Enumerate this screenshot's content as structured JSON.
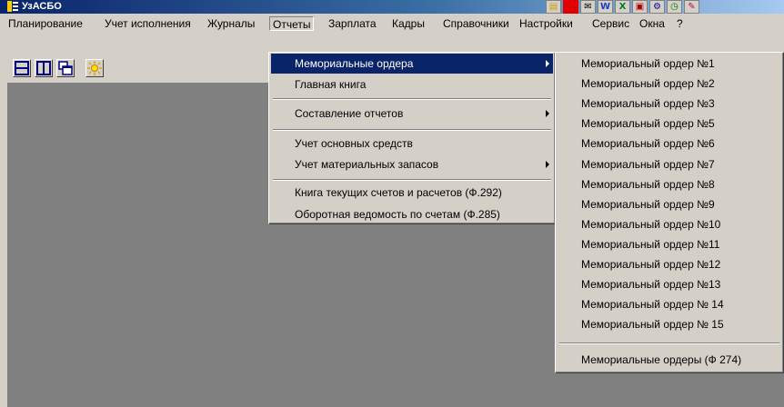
{
  "window": {
    "title": "УзАСБО"
  },
  "task_icons": [
    {
      "icon": "app-tile-icon",
      "glyph": "▤",
      "color": "#c8a000"
    },
    {
      "icon": "red-block-icon",
      "glyph": "",
      "color": "#e00000"
    },
    {
      "icon": "mail-icon",
      "glyph": "✉",
      "color": "#000000"
    },
    {
      "icon": "word-icon",
      "glyph": "W",
      "color": "#1a3dbf"
    },
    {
      "icon": "excel-icon",
      "glyph": "X",
      "color": "#007a33"
    },
    {
      "icon": "access-icon",
      "glyph": "▣",
      "color": "#b00000"
    },
    {
      "icon": "tools-icon",
      "glyph": "⚙",
      "color": "#0000a0"
    },
    {
      "icon": "clock-icon",
      "glyph": "◷",
      "color": "#008000"
    },
    {
      "icon": "notes-icon",
      "glyph": "✎",
      "color": "#c00060"
    }
  ],
  "menubar": {
    "items": [
      "Планирование",
      "Учет исполнения",
      "Журналы",
      "Отчеты",
      "Зарплата",
      "Кадры",
      "Справочники",
      "Настройки",
      "Сервис",
      "Окна",
      "?"
    ],
    "active": "Отчеты"
  },
  "toolbar": {
    "buttons": [
      {
        "icon": "tile-horizontal-icon"
      },
      {
        "icon": "tile-vertical-icon"
      },
      {
        "icon": "cascade-icon"
      },
      {
        "icon": "sun-icon"
      }
    ]
  },
  "reports_menu": {
    "items": [
      {
        "label": "Мемориальные ордера",
        "submenu": true,
        "highlighted": true
      },
      {
        "label": "Главная книга"
      },
      {
        "label": "Составление отчетов",
        "submenu": true
      },
      {
        "label": "Учет основных средств"
      },
      {
        "label": "Учет материальных запасов",
        "submenu": true
      },
      {
        "label": "Книга текущих счетов и расчетов (Ф.292)"
      },
      {
        "label": "Оборотная ведомость по счетам (Ф.285)"
      }
    ]
  },
  "memorial_submenu": {
    "items": [
      "Мемориальный ордер №1",
      "Мемориальный ордер №2",
      "Мемориальный ордер №3",
      "Мемориальный ордер №5",
      "Мемориальный ордер №6",
      "Мемориальный ордер №7",
      "Мемориальный ордер №8",
      "Мемориальный ордер №9",
      "Мемориальный ордер №10",
      "Мемориальный ордер №11",
      "Мемориальный ордер №12",
      "Мемориальный ордер №13",
      "Мемориальный ордер № 14",
      "Мемориальный ордер № 15"
    ],
    "footer_item": "Мемориальные ордеры (Ф 274)"
  }
}
